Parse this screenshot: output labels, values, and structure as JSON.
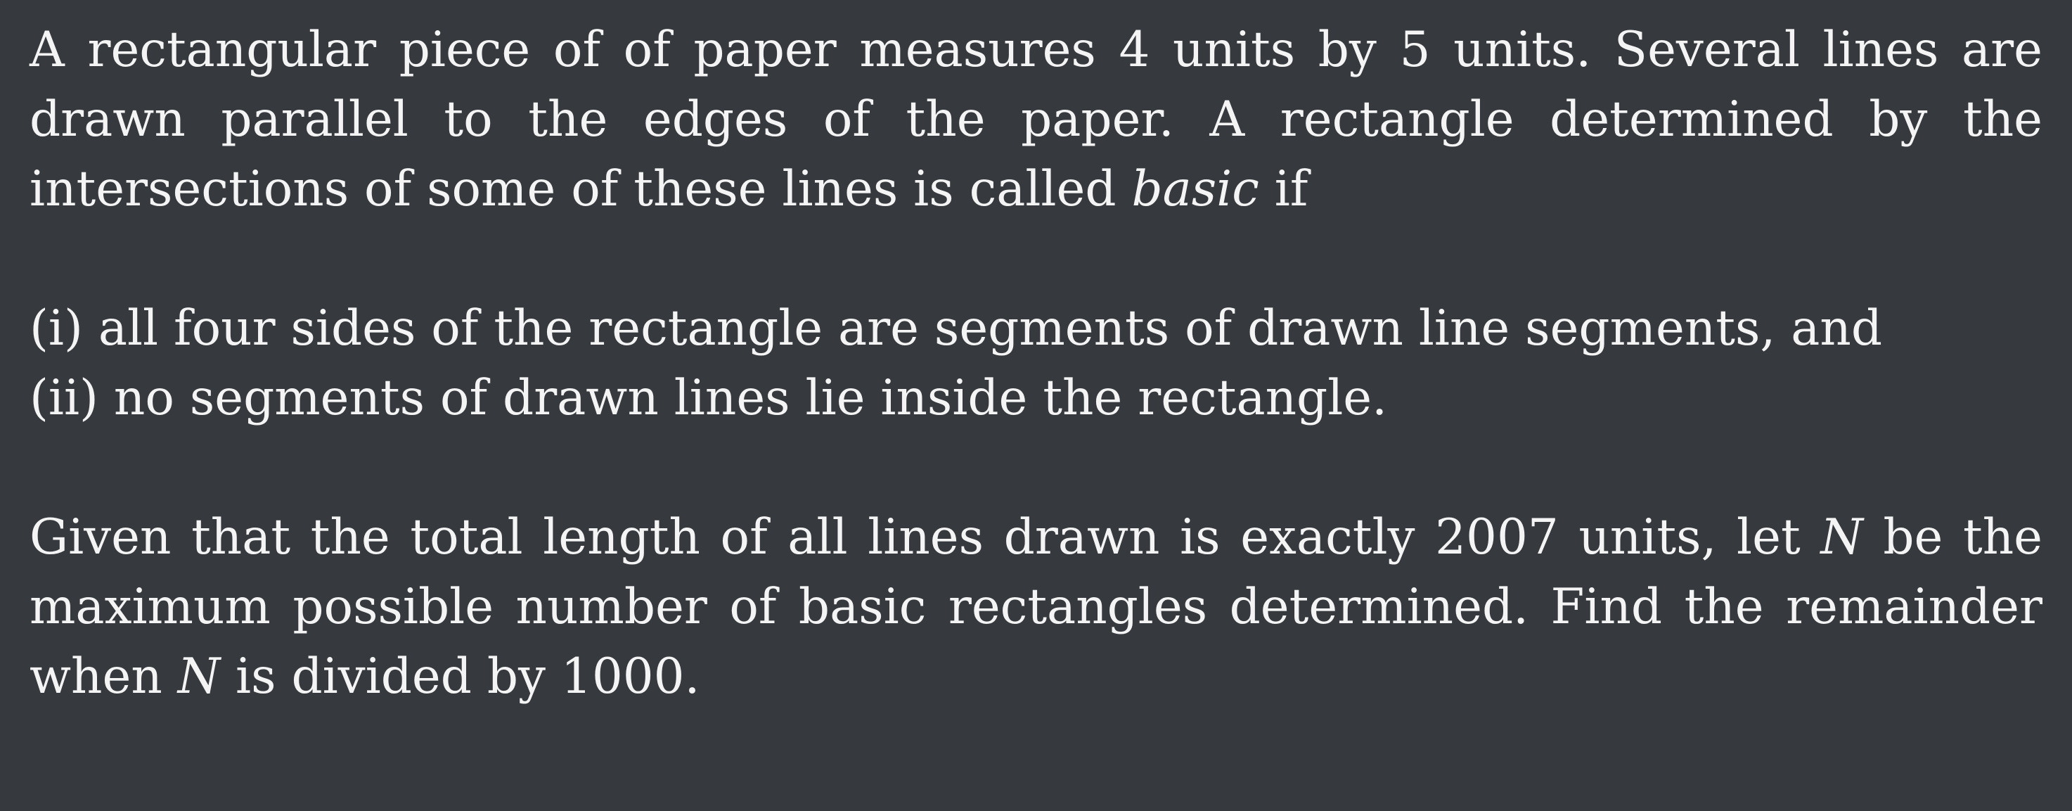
{
  "paragraph1": {
    "text_a": "A rectangular piece of of paper measures 4 units by 5 units. Several lines are drawn parallel to the edges of the paper. A rectangle determined by the intersections of some of these lines is called ",
    "emph": "basic",
    "text_b": " if"
  },
  "condition1": "(i) all four sides of the rectangle are segments of drawn line segments, and",
  "condition2": "(ii) no segments of drawn lines lie inside the rectangle.",
  "paragraph3": {
    "text_a": "Given that the total length of all lines drawn is exactly 2007 units, let ",
    "var1": "N",
    "text_b": " be the maximum possible number of basic rectangles determined. Find the remainder when ",
    "var2": "N",
    "text_c": " is divided by 1000."
  }
}
